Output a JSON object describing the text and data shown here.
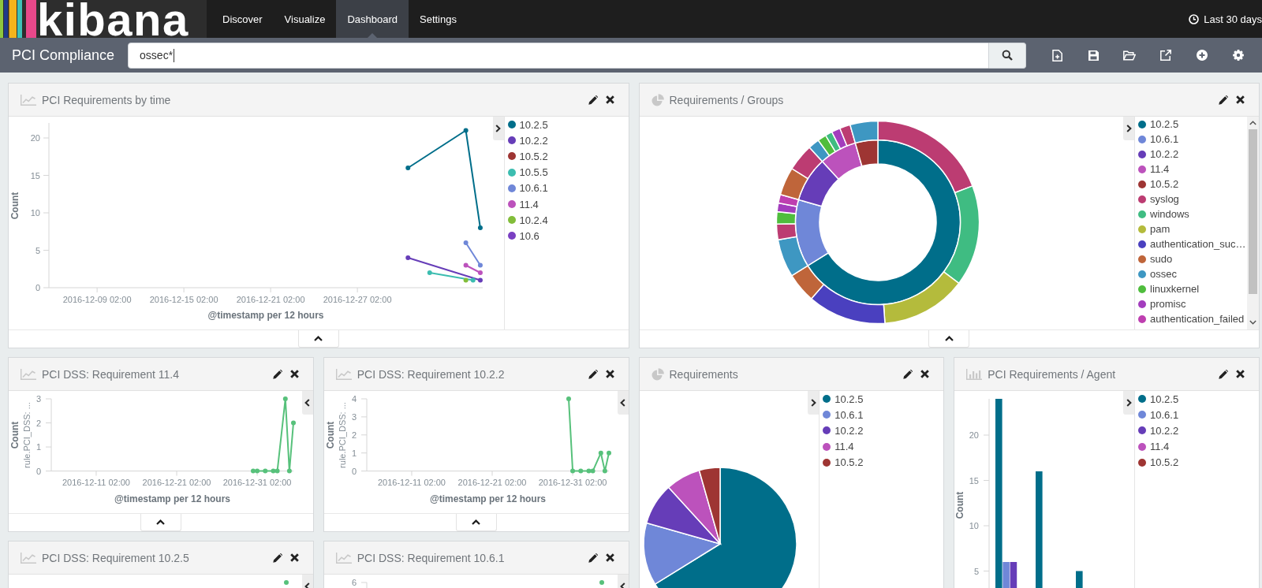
{
  "nav": {
    "logo": "kibana",
    "tabs": [
      {
        "label": "Discover",
        "selected": false
      },
      {
        "label": "Visualize",
        "selected": false
      },
      {
        "label": "Dashboard",
        "selected": true
      },
      {
        "label": "Settings",
        "selected": false
      }
    ],
    "time_range": "Last 30 days"
  },
  "toolbar": {
    "title": "PCI Compliance",
    "query": "ossec*"
  },
  "panels": [
    {
      "title": "PCI Requirements by time",
      "kind": "line",
      "legend": {
        "open": true
      },
      "chart_data": {
        "type": "line",
        "xlabel": "@timestamp per 12 hours",
        "ylabel": "Count",
        "x": [
          "2016-12-30 14:00",
          "2017-01-01 02:00",
          "2017-01-03 14:00",
          "2017-01-04 02:00",
          "2017-01-04 14:00"
        ],
        "series": [
          {
            "name": "10.2.5",
            "color": "#006e8a",
            "marker": true,
            "values": [
              16,
              null,
              21,
              null,
              8
            ]
          },
          {
            "name": "10.2.2",
            "color": "#663db8",
            "marker": true,
            "values": [
              4,
              null,
              null,
              null,
              1
            ]
          },
          {
            "name": "10.5.2",
            "color": "#9e3533",
            "values": [
              null,
              null,
              null,
              null,
              null
            ]
          },
          {
            "name": "10.5.5",
            "color": "#3cbdb0",
            "marker": true,
            "values": [
              null,
              2,
              null,
              1,
              null
            ]
          },
          {
            "name": "10.6.1",
            "color": "#6f87d8",
            "marker": true,
            "values": [
              null,
              null,
              6,
              null,
              3
            ]
          },
          {
            "name": "11.4",
            "color": "#bc52bc",
            "marker": true,
            "values": [
              null,
              null,
              3,
              null,
              2
            ]
          },
          {
            "name": "10.2.4",
            "color": "#82bd3a",
            "marker": true,
            "values": [
              null,
              null,
              1,
              null,
              null
            ]
          },
          {
            "name": "10.6",
            "color": "#7a40c2",
            "values": [
              null,
              null,
              null,
              null,
              null
            ]
          }
        ],
        "xlim": [
          "2016-12-05 18:00",
          "2017-01-04 18:00"
        ],
        "ylim": [
          0,
          22
        ],
        "xticks": [
          "2016-12-09 02:00",
          "2016-12-15 02:00",
          "2016-12-21 02:00",
          "2016-12-27 02:00"
        ],
        "yticks": [
          0,
          5,
          10,
          15,
          20
        ]
      }
    },
    {
      "title": "Requirements / Groups",
      "kind": "donut",
      "legend": {
        "open": true,
        "items": [
          {
            "label": "10.2.5",
            "color": "#006e8a"
          },
          {
            "label": "10.6.1",
            "color": "#6f87d8"
          },
          {
            "label": "10.2.2",
            "color": "#663db8"
          },
          {
            "label": "11.4",
            "color": "#bc52bc"
          },
          {
            "label": "10.5.2",
            "color": "#9e3533"
          },
          {
            "label": "syslog",
            "color": "#bc3c72"
          },
          {
            "label": "windows",
            "color": "#3fbc82"
          },
          {
            "label": "pam",
            "color": "#b4bb3c"
          },
          {
            "label": "authentication_suc…",
            "color": "#4a40bf"
          },
          {
            "label": "sudo",
            "color": "#bf653a"
          },
          {
            "label": "ossec",
            "color": "#3e97c2"
          },
          {
            "label": "linuxkernel",
            "color": "#4fbd3d"
          },
          {
            "label": "promisc",
            "color": "#a33dbd"
          },
          {
            "label": "authentication_failed",
            "color": "#be3fb0"
          }
        ]
      }
    },
    {
      "title": "PCI DSS: Requirement 11.4",
      "kind": "line",
      "split_label": "rule.PCI_DSS: ...",
      "legend": {
        "open": false
      },
      "chart_data": {
        "type": "line",
        "xlabel": "@timestamp per 12 hours",
        "ylabel": "Count",
        "x": [
          "2016-12-30 14:00",
          "2016-12-31 02:00",
          "2017-01-01 02:00",
          "2017-01-02 02:00",
          "2017-01-02 14:00",
          "2017-01-03 14:00",
          "2017-01-04 02:00",
          "2017-01-04 14:00"
        ],
        "series": [
          {
            "color": "#57c17b",
            "marker": true,
            "values": [
              0,
              0,
              0,
              0,
              0,
              3,
              0,
              2
            ]
          }
        ],
        "xlim": [
          "2016-12-05 12:00",
          "2017-01-04 14:00"
        ],
        "ylim": [
          0,
          3
        ],
        "xticks": [
          "2016-12-11 02:00",
          "2016-12-21 02:00",
          "2016-12-31 02:00"
        ],
        "yticks": [
          0,
          1,
          2,
          3
        ]
      }
    },
    {
      "title": "PCI DSS: Requirement 10.2.2",
      "kind": "line",
      "split_label": "rule.PCI_DSS: ...",
      "legend": {
        "open": false
      },
      "chart_data": {
        "type": "line",
        "xlabel": "@timestamp per 12 hours",
        "ylabel": "Count",
        "x": [
          "2016-12-30 14:00",
          "2016-12-31 02:00",
          "2017-01-01 02:00",
          "2017-01-02 02:00",
          "2017-01-02 14:00",
          "2017-01-03 14:00",
          "2017-01-04 02:00",
          "2017-01-04 14:00"
        ],
        "series": [
          {
            "color": "#57c17b",
            "marker": true,
            "values": [
              4,
              0,
              0,
              0,
              0,
              1,
              0,
              1
            ]
          }
        ],
        "xlim": [
          "2016-12-05 12:00",
          "2017-01-04 14:00"
        ],
        "ylim": [
          0,
          4
        ],
        "xticks": [
          "2016-12-11 02:00",
          "2016-12-21 02:00",
          "2016-12-31 02:00"
        ],
        "yticks": [
          0,
          1,
          2,
          3,
          4
        ]
      }
    },
    {
      "title": "Requirements",
      "kind": "pie",
      "legend": {
        "open": true,
        "items": [
          {
            "label": "10.2.5",
            "color": "#006e8a"
          },
          {
            "label": "10.6.1",
            "color": "#6f87d8"
          },
          {
            "label": "10.2.2",
            "color": "#663db8"
          },
          {
            "label": "11.4",
            "color": "#bc52bc"
          },
          {
            "label": "10.5.2",
            "color": "#9e3533"
          }
        ]
      }
    },
    {
      "title": "PCI Requirements / Agent",
      "kind": "bar",
      "ylabel": "Count",
      "y_ticks": [
        "20",
        "15",
        "10",
        "5"
      ],
      "legend": {
        "open": true,
        "items": [
          {
            "label": "10.2.5",
            "color": "#006e8a"
          },
          {
            "label": "10.6.1",
            "color": "#6f87d8"
          },
          {
            "label": "10.2.2",
            "color": "#663db8"
          },
          {
            "label": "11.4",
            "color": "#bc52bc"
          },
          {
            "label": "10.5.2",
            "color": "#9e3533"
          }
        ]
      }
    },
    {
      "title": "PCI DSS: Requirement 10.2.5",
      "kind": "line",
      "legend": {
        "open": false
      }
    },
    {
      "title": "PCI DSS: Requirement 10.6.1",
      "kind": "line",
      "legend": {
        "open": false
      },
      "top_tick": "6"
    }
  ]
}
